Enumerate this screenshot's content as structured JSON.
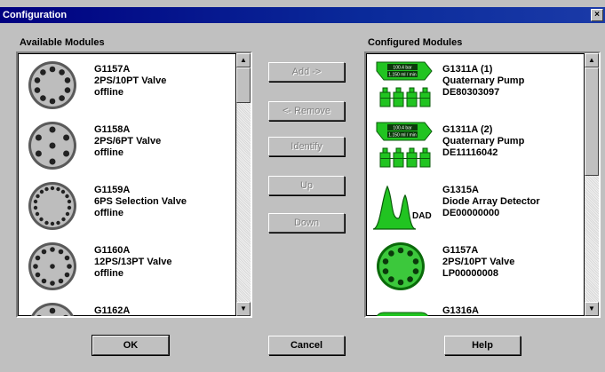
{
  "window": {
    "title": "Configuration",
    "close_glyph": "×"
  },
  "available": {
    "label": "Available Modules",
    "items": [
      {
        "icon": "valve-10-port-icon",
        "line1": "G1157A",
        "line2": "2PS/10PT Valve",
        "line3": "offline"
      },
      {
        "icon": "valve-6-port-icon",
        "line1": "G1158A",
        "line2": "2PS/6PT Valve",
        "line3": "offline"
      },
      {
        "icon": "selection-valve-icon",
        "line1": "G1159A",
        "line2": "6PS Selection Valve",
        "line3": "offline"
      },
      {
        "icon": "valve-13-port-icon",
        "line1": "G1160A",
        "line2": "12PS/13PT Valve",
        "line3": "offline"
      },
      {
        "icon": "valve-icon",
        "line1": "G1162A",
        "line2": "",
        "line3": ""
      }
    ]
  },
  "actions": {
    "add": "Add ->",
    "remove": "<- Remove",
    "identify": "Identify",
    "up": "Up",
    "down": "Down"
  },
  "configured": {
    "label": "Configured Modules",
    "items": [
      {
        "icon": "quaternary-pump-icon",
        "line1": "G1311A (1)",
        "line2": "Quaternary Pump",
        "line3": "DE80303097"
      },
      {
        "icon": "quaternary-pump-icon",
        "line1": "G1311A (2)",
        "line2": "Quaternary Pump",
        "line3": "DE11116042"
      },
      {
        "icon": "diode-array-detector-icon",
        "line1": "G1315A",
        "line2": "Diode Array Detector",
        "line3": "DE00000000",
        "icon_label": "DAD"
      },
      {
        "icon": "valve-10-port-green-icon",
        "line1": "G1157A",
        "line2": "2PS/10PT Valve",
        "line3": "LP00000008"
      },
      {
        "icon": "module-icon",
        "line1": "G1316A",
        "line2": "",
        "line3": ""
      }
    ],
    "pump_display": {
      "line1": "100.4 bar",
      "line2": "1.150 ml / min"
    }
  },
  "footer": {
    "ok": "OK",
    "cancel": "Cancel",
    "help": "Help"
  },
  "scroll": {
    "up_glyph": "▲",
    "down_glyph": "▼"
  },
  "colors": {
    "title_bar": "#000080",
    "face": "#c0c0c0",
    "pump_green": "#21c421",
    "valve_gray": "#bdbdbd"
  }
}
